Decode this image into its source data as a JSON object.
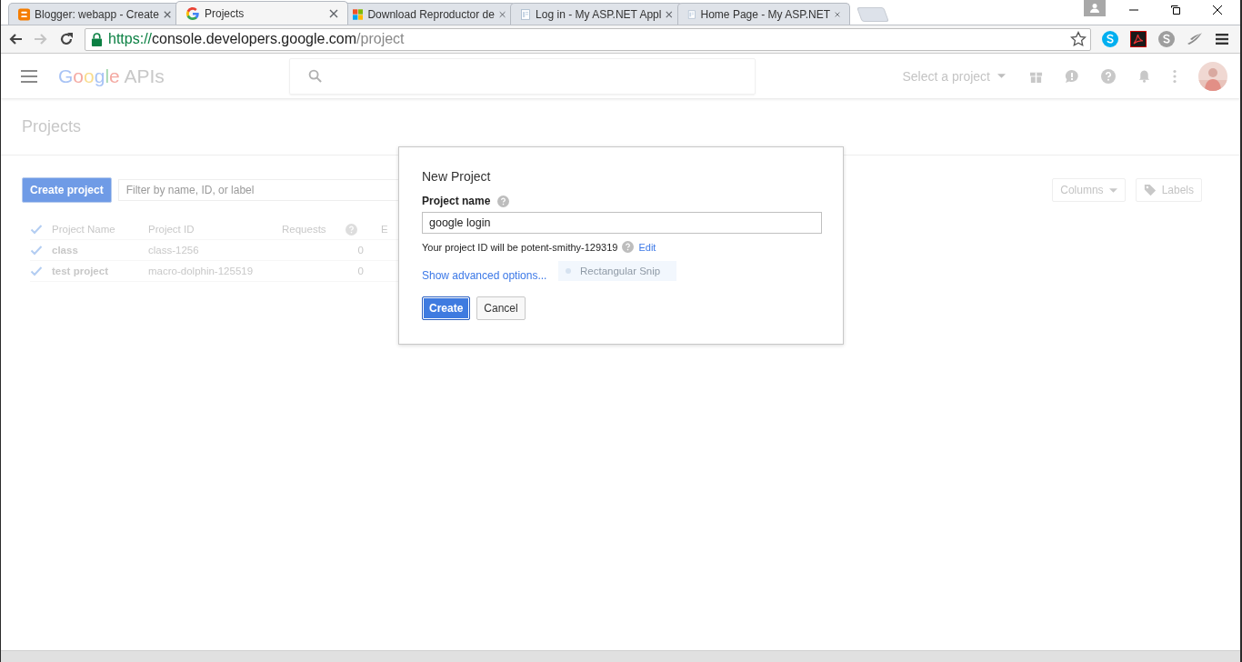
{
  "browser": {
    "tabs": [
      {
        "title": "Blogger: webapp - Create",
        "kind": "blogger",
        "selected": false
      },
      {
        "title": "Projects",
        "kind": "google",
        "selected": true
      },
      {
        "title": "Download Reproductor de",
        "kind": "windows",
        "selected": false
      },
      {
        "title": "Log in - My ASP.NET Appl",
        "kind": "page",
        "selected": false
      },
      {
        "title": "Home Page - My ASP.NET",
        "kind": "page",
        "selected": false
      }
    ],
    "url": {
      "scheme": "https://",
      "host": "console.developers.google.com",
      "path": "/project"
    }
  },
  "app_bar": {
    "logo": "Google",
    "product": "APIs",
    "project_selector": "Select a project"
  },
  "page": {
    "title": "Projects",
    "create_button": "Create project",
    "filter_placeholder": "Filter by name, ID, or label",
    "columns_button": "Columns",
    "labels_button": "Labels",
    "table": {
      "all_checked": true,
      "columns": [
        "Project Name",
        "Project ID",
        "Requests",
        "E"
      ],
      "rows": [
        {
          "checked": true,
          "cells": [
            "class",
            "class-1256",
            "0"
          ]
        },
        {
          "checked": true,
          "cells": [
            "test project",
            "macro-dolphin-125519",
            "0"
          ]
        }
      ]
    }
  },
  "dialog": {
    "title": "New Project",
    "field_label": "Project name",
    "field_value": "google login",
    "id_note": "Your project ID will be potent-smithy-129319",
    "edit_link": "Edit",
    "advanced_link": "Show advanced options...",
    "buttons": [
      {
        "label": "Create",
        "kind": "primary"
      },
      {
        "label": "Cancel",
        "kind": "secondary"
      }
    ]
  },
  "snip_tooltip": "Rectangular Snip"
}
